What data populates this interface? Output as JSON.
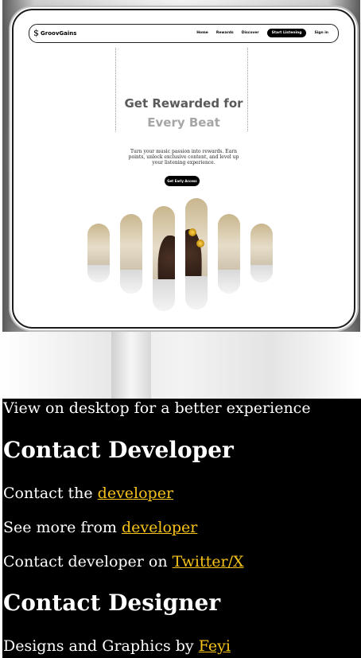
{
  "nav": {
    "logo_symbol": "$",
    "logo_text": "GroovGains",
    "links": [
      "Home",
      "Rewards",
      "Discover"
    ],
    "cta": "Start Listening",
    "signin": "Sign in"
  },
  "hero": {
    "title_line1": "Get Rewarded for",
    "title_line2": "Every Beat",
    "subtitle": "Turn your music passion into rewards. Earn points, unlock exclusive content, and level up your listening experience.",
    "button": "Get Early Access"
  },
  "info": {
    "notice": "View on desktop for a better experience",
    "developer_heading": "Contact Developer",
    "dev_line1_text": "Contact the ",
    "dev_line1_link": "developer",
    "dev_line2_text": "See more from ",
    "dev_line2_link": "developer",
    "dev_line3_text": "Contact developer on ",
    "dev_line3_link": "Twitter/X",
    "designer_heading": "Contact Designer",
    "designer_line_text": "Designs and Graphics by ",
    "designer_line_link": "Feyi"
  },
  "colors": {
    "link": "#f6c21a",
    "panel_bg": "#000000",
    "button_bg": "#000000"
  }
}
